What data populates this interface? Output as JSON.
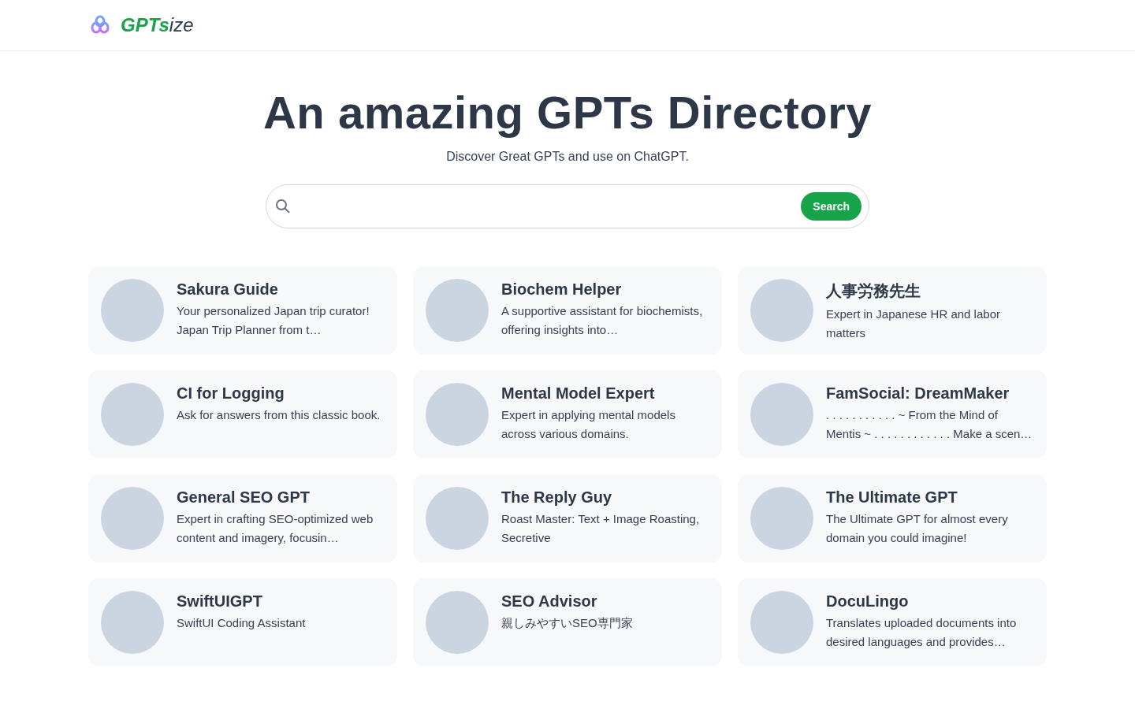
{
  "logo": {
    "strong": "GPTs",
    "rest": "ize"
  },
  "hero": {
    "title": "An amazing GPTs Directory",
    "subtitle": "Discover Great GPTs and use on ChatGPT."
  },
  "search": {
    "button": "Search"
  },
  "cards": [
    {
      "title": "Sakura Guide",
      "description": "Your personalized Japan trip curator! Japan Trip Planner from t…"
    },
    {
      "title": "Biochem Helper",
      "description": "A supportive assistant for biochemists, offering insights into…"
    },
    {
      "title": "人事労務先生",
      "description": "Expert in Japanese HR and labor matters"
    },
    {
      "title": "CI for Logging",
      "description": "Ask for answers from this classic book."
    },
    {
      "title": "Mental Model Expert",
      "description": "Expert in applying mental models across various domains."
    },
    {
      "title": "FamSocial: DreamMaker",
      "description": ". . . . . . . . . . . ~ From the Mind of Mentis ~ . . . . . . . . . . . . Make a scen…"
    },
    {
      "title": "General SEO GPT",
      "description": "Expert in crafting SEO-optimized web content and imagery, focusin…"
    },
    {
      "title": "The Reply Guy",
      "description": "Roast Master: Text + Image Roasting, Secretive"
    },
    {
      "title": "The Ultimate GPT",
      "description": "The Ultimate GPT for almost every domain you could imagine!"
    },
    {
      "title": "SwiftUIGPT",
      "description": "SwiftUI Coding Assistant"
    },
    {
      "title": "SEO Advisor",
      "description": "親しみやすいSEO専門家"
    },
    {
      "title": "DocuLingo",
      "description": "Translates uploaded documents into desired languages and provides…"
    }
  ]
}
